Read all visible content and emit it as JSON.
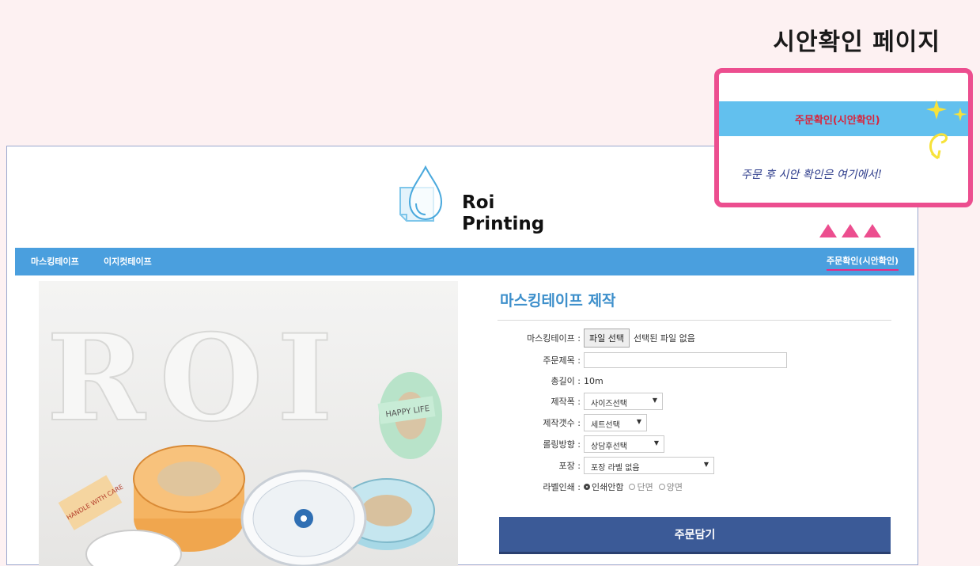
{
  "page_heading": "시안확인 페이지",
  "logo": {
    "line1": "Roi",
    "line2": "Printing"
  },
  "nav": {
    "items": [
      "마스킹테이프",
      "이지컷테이프"
    ],
    "right_link": "주문확인(시안확인)"
  },
  "photo": {
    "letters": "ROI",
    "tape_text": "HAPPY LIFE",
    "label_text": "HANDLE WITH CARE"
  },
  "form": {
    "title": "마스킹테이프 제작",
    "fields": {
      "file": {
        "label": "마스킹테이프 :",
        "button": "파일 선택",
        "status": "선택된 파일 없음"
      },
      "order_title": {
        "label": "주문제목 :",
        "value": ""
      },
      "length": {
        "label": "총길이 :",
        "value": "10m"
      },
      "width": {
        "label": "제작폭 :",
        "selected": "사이즈선택"
      },
      "quantity": {
        "label": "제작갯수 :",
        "selected": "세트선택"
      },
      "roll_direction": {
        "label": "롤링방향 :",
        "selected": "상담후선택"
      },
      "packaging": {
        "label": "포장 :",
        "selected": "포장 라벨 없음"
      },
      "label_print": {
        "label": "라벨인쇄 :",
        "options": [
          "인쇄안함",
          "단면",
          "양면"
        ],
        "selected": "인쇄안함"
      }
    },
    "submit_label": "주문담기"
  },
  "callout": {
    "band_text": "주문확인(시안확인)",
    "note": "주문 후 시안 확인은 여기에서!"
  },
  "colors": {
    "background": "#fdf1f2",
    "nav": "#4a9fde",
    "accent_pink": "#ec4e8f",
    "submit": "#3b5a97",
    "title_blue": "#3d8fcb",
    "callout_band": "#62c0ee"
  }
}
